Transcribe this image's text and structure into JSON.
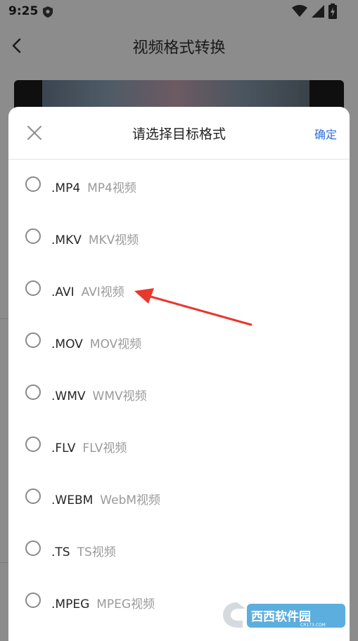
{
  "status_bar": {
    "time": "9:25"
  },
  "header": {
    "title": "视频格式转换"
  },
  "sheet": {
    "title": "请选择目标格式",
    "confirm_label": "确定",
    "options": [
      {
        "ext": ".MP4",
        "desc": "MP4视频"
      },
      {
        "ext": ".MKV",
        "desc": "MKV视频"
      },
      {
        "ext": ".AVI",
        "desc": "AVI视频"
      },
      {
        "ext": ".MOV",
        "desc": "MOV视频"
      },
      {
        "ext": ".WMV",
        "desc": "WMV视频"
      },
      {
        "ext": ".FLV",
        "desc": "FLV视频"
      },
      {
        "ext": ".WEBM",
        "desc": "WebM视频"
      },
      {
        "ext": ".TS",
        "desc": "TS视频"
      },
      {
        "ext": ".MPEG",
        "desc": "MPEG视频"
      }
    ]
  },
  "watermark": {
    "text": "西西软件园",
    "sub": "CR173.COM"
  },
  "colors": {
    "accent": "#2f6fd6",
    "arrow": "#e8372c",
    "scrim": "#8c8c8c"
  }
}
